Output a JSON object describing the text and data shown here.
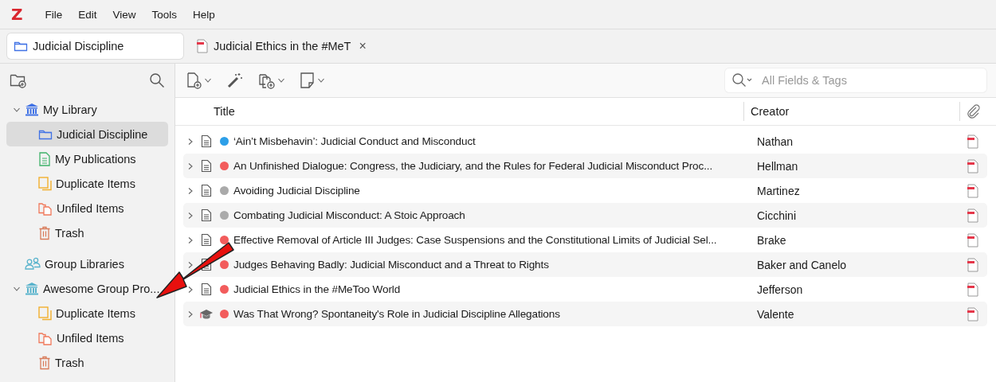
{
  "app_logo": "Z",
  "menu": [
    "File",
    "Edit",
    "View",
    "Tools",
    "Help"
  ],
  "tabs": [
    {
      "label": "Judicial Discipline",
      "kind": "collection",
      "selected": true
    },
    {
      "label": "Judicial Ethics in the #MeT",
      "kind": "pdf",
      "selected": false,
      "close": "×"
    }
  ],
  "search": {
    "placeholder": "All Fields & Tags"
  },
  "sidebar": {
    "items": [
      {
        "label": "My Library",
        "kind": "library",
        "expanded": true,
        "selected": false,
        "children": [
          {
            "label": "Judicial Discipline",
            "kind": "collection",
            "selected": true
          },
          {
            "label": "My Publications",
            "kind": "publications",
            "selected": false
          },
          {
            "label": "Duplicate Items",
            "kind": "duplicates",
            "selected": false
          },
          {
            "label": "Unfiled Items",
            "kind": "unfiled",
            "selected": false
          },
          {
            "label": "Trash",
            "kind": "trash",
            "selected": false
          }
        ]
      },
      {
        "label": "Group Libraries",
        "kind": "groups",
        "selected": false
      },
      {
        "label": "Awesome Group Pro...",
        "kind": "group",
        "expanded": true,
        "selected": false,
        "children": [
          {
            "label": "Duplicate Items",
            "kind": "duplicates",
            "selected": false
          },
          {
            "label": "Unfiled Items",
            "kind": "unfiled",
            "selected": false
          },
          {
            "label": "Trash",
            "kind": "trash",
            "selected": false
          }
        ]
      }
    ]
  },
  "table": {
    "columns": [
      "Title",
      "Creator"
    ],
    "rows": [
      {
        "title": "‘Ain’t Misbehavin’: Judicial Conduct and Misconduct",
        "creator": "Nathan",
        "kind": "document",
        "color": "#2d9fe8"
      },
      {
        "title": "An Unfinished Dialogue: Congress, the Judiciary, and the Rules for Federal Judicial Misconduct Proc...",
        "creator": "Hellman",
        "kind": "document",
        "color": "#f25c5c"
      },
      {
        "title": "Avoiding Judicial Discipline",
        "creator": "Martinez",
        "kind": "document",
        "color": "#aaaaaa"
      },
      {
        "title": "Combating Judicial Misconduct: A Stoic Approach",
        "creator": "Cicchini",
        "kind": "document",
        "color": "#aaaaaa"
      },
      {
        "title": "Effective Removal of Article III Judges: Case Suspensions and the Constitutional Limits of Judicial Sel...",
        "creator": "Brake",
        "kind": "document",
        "color": "#f25c5c"
      },
      {
        "title": "Judges Behaving Badly: Judicial Misconduct and a Threat to Rights",
        "creator": "Baker and Canelo",
        "kind": "document",
        "color": "#f25c5c"
      },
      {
        "title": "Judicial Ethics in the #MeToo World",
        "creator": "Jefferson",
        "kind": "document",
        "color": "#f25c5c"
      },
      {
        "title": "Was That Wrong? Spontaneity's Role in Judicial Discipline Allegations",
        "creator": "Valente",
        "kind": "thesis",
        "color": "#f25c5c"
      }
    ]
  }
}
